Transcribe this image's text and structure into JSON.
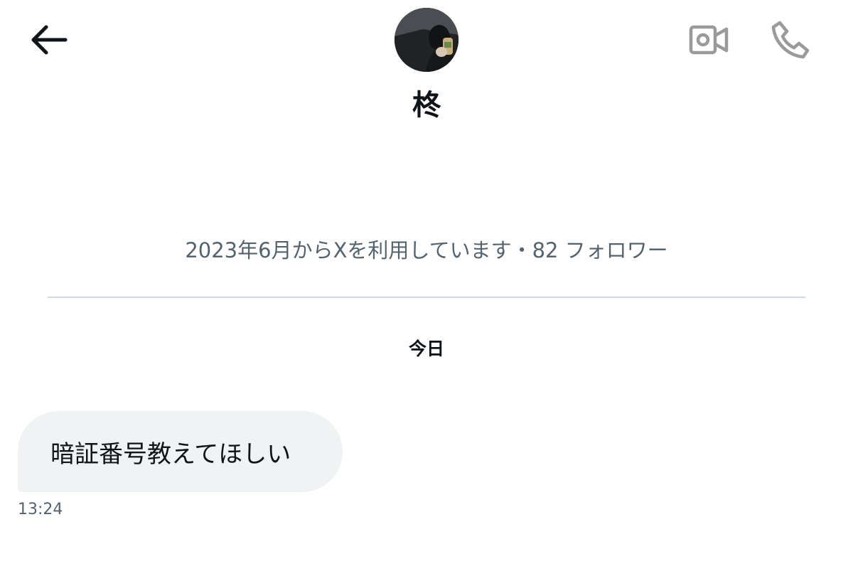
{
  "header": {
    "back_icon": "arrow-left-icon",
    "video_call_icon": "video-camera-icon",
    "voice_call_icon": "phone-icon",
    "icon_color": "#9a9a9a"
  },
  "profile": {
    "display_name": "柊",
    "meta": "2023年6月からXを利用しています・82 フォロワー"
  },
  "conversation": {
    "date_label": "今日",
    "messages": [
      {
        "text": "暗証番号教えてほしい",
        "time": "13:24",
        "direction": "received"
      }
    ]
  },
  "colors": {
    "text_primary": "#0f1419",
    "text_secondary": "#536471",
    "bubble_received": "#eff3f4",
    "divider": "#cfd9de"
  }
}
